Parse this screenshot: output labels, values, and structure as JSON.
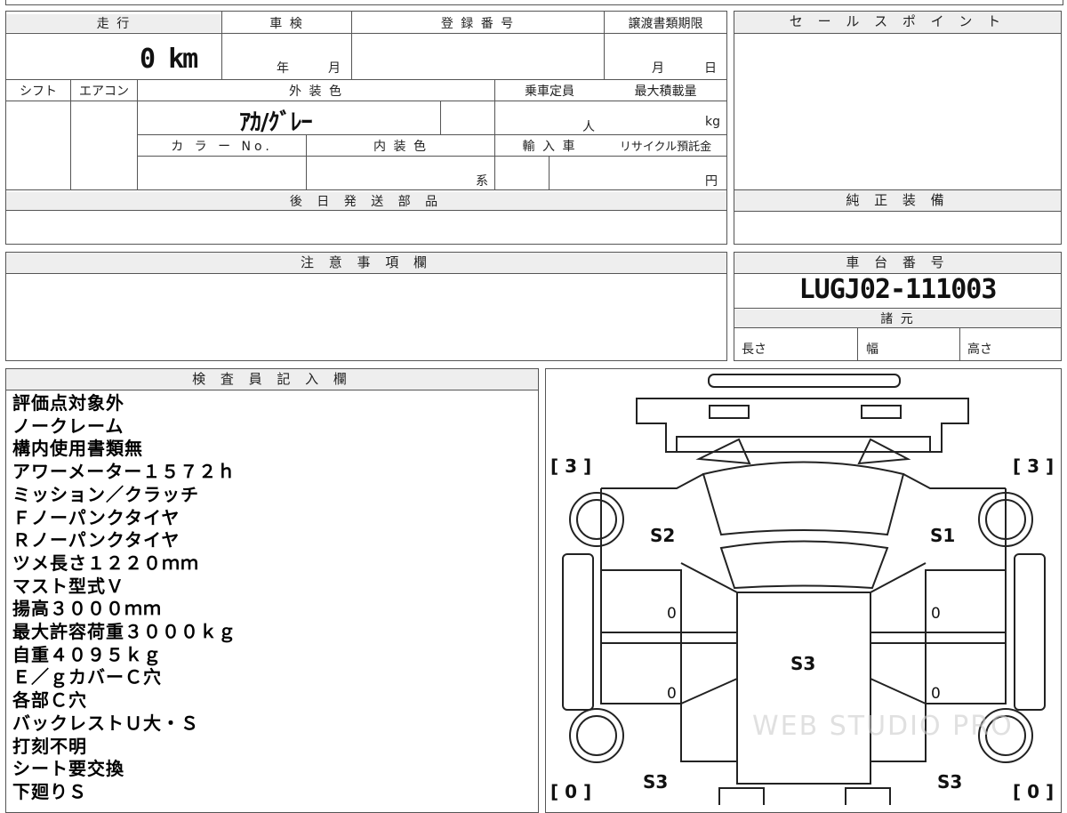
{
  "vehicle": {
    "mileage_label": "走 行",
    "mileage_value": "0 km",
    "inspection_label": "車 検",
    "inspection_year_unit": "年",
    "inspection_month_unit": "月",
    "registration_label": "登 録 番 号",
    "transfer_label": "譲渡書類期限",
    "transfer_month_unit": "月",
    "transfer_day_unit": "日",
    "shift_label": "シフト",
    "ac_label": "エアコン",
    "exterior_label": "外 装 色",
    "exterior_value": "ｱｶ/ｸﾞﾚｰ",
    "capacity_label": "乗車定員",
    "capacity_unit": "人",
    "max_load_label": "最大積載量",
    "max_load_unit": "kg",
    "color_no_label": "カ ラ ー No.",
    "interior_label": "内 装 色",
    "interior_unit": "系",
    "import_label": "輸 入 車",
    "recycle_label": "リサイクル預託金",
    "recycle_unit": "円",
    "later_parts_label": "後 日 発 送 部 品",
    "sale_points_label": "セ ー ル ス ポ イ ン ト",
    "genuine_equipment_label": "純 正 装 備",
    "notes_label": "注 意 事 項 欄",
    "chassis_label": "車 台 番 号",
    "chassis_value": "LUGJ02-111003",
    "specs_label": "諸 元",
    "length_label": "長さ",
    "width_label": "幅",
    "height_label": "高さ"
  },
  "inspector": {
    "title": "検 査 員 記 入 欄",
    "lines": [
      "評価点対象外",
      "ノークレーム",
      "構内使用書類無",
      "アワーメーター１５７２ｈ",
      "ミッション／クラッチ",
      "Ｆノーパンクタイヤ",
      "Ｒノーパンクタイヤ",
      "ツメ長さ１２２０ｍｍ",
      "マスト型式Ｖ",
      "揚高３０００ｍｍ",
      "最大許容荷重３０００ｋｇ",
      "自重４０９５ｋｇ",
      "Ｅ／ｇカバーＣ穴",
      "各部Ｃ穴",
      "バックレストＵ大・Ｓ",
      "打刻不明",
      "シート要交換",
      "下廻りＳ"
    ]
  },
  "diagram": {
    "tire_fl": "[ 3 ]",
    "tire_fr": "[ 3 ]",
    "tire_rl": "[ 0 ]",
    "tire_rr": "[ 0 ]",
    "mark_s2": "S2",
    "mark_s1": "S1",
    "mark_s3_center": "S3",
    "mark_s3_rear_left": "S3",
    "mark_s3_rear_right": "S3",
    "door_fl": "0",
    "door_fr": "0",
    "door_rl": "0",
    "door_rr": "0",
    "watermark": "WEB STUDIO PRO"
  }
}
